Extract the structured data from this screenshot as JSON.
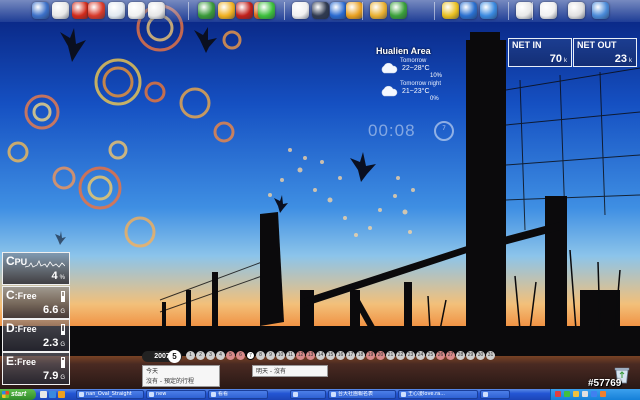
{
  "dock": {
    "icons": [
      {
        "name": "desktop-icon",
        "color": "#3c70c8"
      },
      {
        "name": "mail-icon",
        "color": "#e8e8e8"
      },
      {
        "name": "acrobat-icon",
        "color": "#d12a1a"
      },
      {
        "name": "toolbox-icon",
        "color": "#d83a2a"
      },
      {
        "name": "puzzle-icon",
        "color": "#e0e8f0"
      },
      {
        "name": "notes-icon",
        "color": "#f0f0f0"
      },
      {
        "name": "document-icon",
        "color": "#e6e6e6"
      },
      {
        "name": "globe-icon",
        "color": "#3a9a3a"
      },
      {
        "name": "sun-icon",
        "color": "#f0b020"
      },
      {
        "name": "record-icon",
        "color": "#c0201a"
      },
      {
        "name": "arrow-icon",
        "color": "#e07020"
      },
      {
        "name": "green-ball-icon",
        "color": "#3cbf3c"
      },
      {
        "name": "media-player-icon",
        "color": "#f0f0f0"
      },
      {
        "name": "film-icon",
        "color": "#303a50"
      },
      {
        "name": "x-icon",
        "color": "#2a6ad0"
      },
      {
        "name": "picture-icon",
        "color": "#e9a020"
      },
      {
        "name": "monkey-icon",
        "color": "#e8b030"
      },
      {
        "name": "messenger-icon",
        "color": "#3aa03a"
      },
      {
        "name": "pencil-icon",
        "color": "#e9c020"
      },
      {
        "name": "network-icon",
        "color": "#2a70d0"
      },
      {
        "name": "browser-icon",
        "color": "#3a8ae0"
      },
      {
        "name": "speaker-icon",
        "color": "#e8e8e8"
      },
      {
        "name": "envelope-icon",
        "color": "#f0f0f0"
      },
      {
        "name": "pen-icon",
        "color": "#e0e0e0"
      },
      {
        "name": "dialog-icon",
        "color": "#4a8ad8"
      }
    ]
  },
  "weather": {
    "title": "Hualien Area",
    "rows": [
      {
        "label": "Tomorrow",
        "temp": "22~28°C",
        "humidity": "10%"
      },
      {
        "label": "Tomorrow night",
        "temp": "21~23°C",
        "humidity": "0%"
      }
    ]
  },
  "clock": {
    "time": "00:08",
    "ring": "7"
  },
  "network": {
    "in": {
      "label": "NET IN",
      "value": "70",
      "unit": "k"
    },
    "out": {
      "label": "NET OUT",
      "value": "23",
      "unit": "k"
    }
  },
  "meters": [
    {
      "key": "cpu",
      "cap": "C",
      "label": "PU",
      "value": "4",
      "unit": "%",
      "level": 0.04
    },
    {
      "key": "c",
      "cap": "C",
      "label": ":Free",
      "value": "6.6",
      "unit": "G",
      "level": 0.6
    },
    {
      "key": "d",
      "cap": "D",
      "label": ":Free",
      "value": "2.3",
      "unit": "G",
      "level": 0.3
    },
    {
      "key": "e",
      "cap": "E",
      "label": ":Free",
      "value": "7.9",
      "unit": "G",
      "level": 0.8
    }
  ],
  "calendar": {
    "year": "2007",
    "month": "5",
    "days": [
      "1",
      "2",
      "3",
      "4",
      "5",
      "6",
      "7",
      "8",
      "9",
      "10",
      "11",
      "12",
      "13",
      "14",
      "15",
      "16",
      "17",
      "18",
      "19",
      "20",
      "21",
      "22",
      "23",
      "24",
      "25",
      "26",
      "27",
      "28",
      "29",
      "30",
      "31"
    ],
    "weekends": [
      "5",
      "6",
      "12",
      "13",
      "19",
      "20",
      "26",
      "27"
    ],
    "today": "7",
    "note_today_title": "今天",
    "note_today_text": "沒有 - 預定的行程",
    "note_tomorrow_text": "明天 - 沒有"
  },
  "taskbar": {
    "start_label": "start",
    "tasks": [
      {
        "label": "nan_Oval_Straight"
      },
      {
        "label": "new"
      },
      {
        "label": "看看"
      },
      {
        "label": "台大社團報名表"
      },
      {
        "label": "王心凌love.ra..."
      }
    ]
  },
  "watermark": "#57769"
}
